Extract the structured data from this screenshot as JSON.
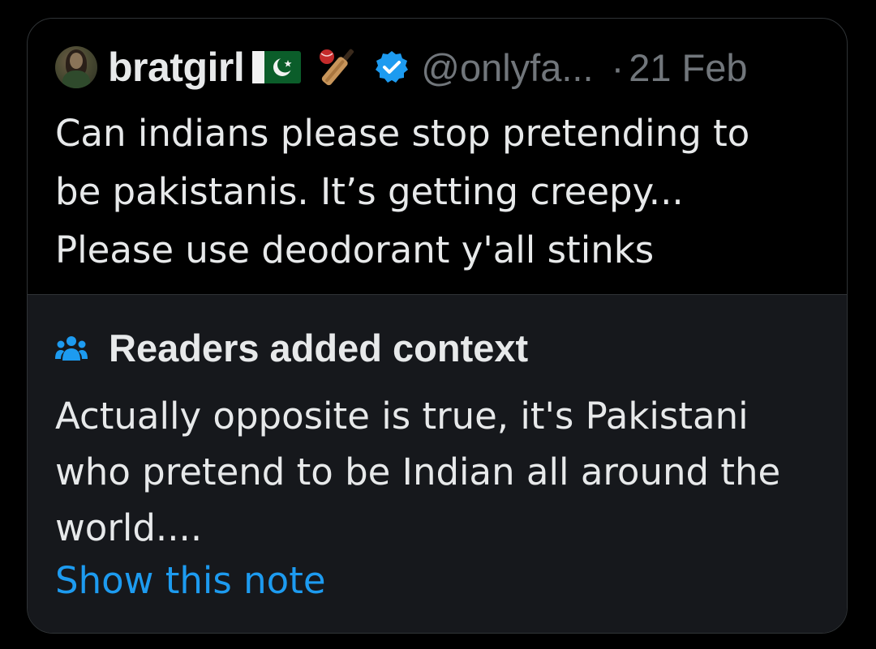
{
  "post": {
    "display_name": "bratgirl",
    "flag_icon": "pakistan-flag-icon",
    "emoji_icon": "cricket-bat-and-ball-icon",
    "verified_icon": "verified-badge-icon",
    "handle": "@onlyfa...",
    "separator": "·",
    "date": "21 Feb",
    "text_lines": [
      "Can indians please stop pretending to",
      "be pakistanis. It’s getting creepy...",
      "Please use deodorant y'all stinks"
    ]
  },
  "community_note": {
    "icon": "people-icon",
    "title": "Readers added context",
    "text_lines": [
      "Actually opposite is true, it's Pakistani",
      "who pretend to be Indian all around the",
      "world...."
    ],
    "link_label": "Show this note"
  },
  "colors": {
    "background": "#000000",
    "note_background": "#16181c",
    "primary_text": "#e7e9ea",
    "secondary_text": "#71767b",
    "accent": "#1d9bf0"
  }
}
